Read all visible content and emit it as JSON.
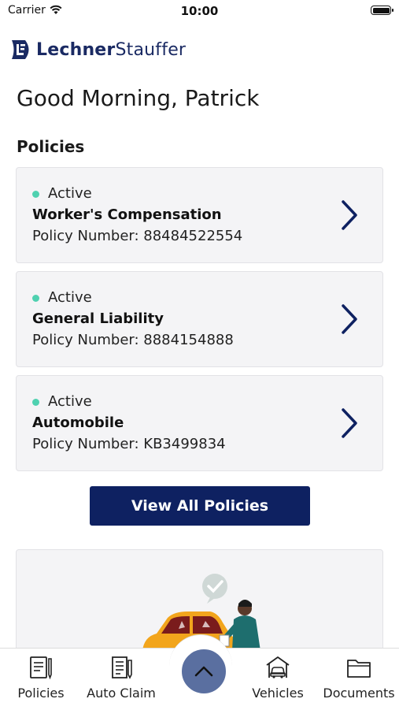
{
  "status_bar": {
    "carrier": "Carrier",
    "time": "10:00"
  },
  "brand": {
    "part1": "Lechner",
    "part2": "Stauffer"
  },
  "greeting": "Good Morning, Patrick",
  "policies_section": {
    "title": "Policies",
    "items": [
      {
        "status": "Active",
        "name": "Worker's Compensation",
        "policy_number": "Policy Number: 88484522554"
      },
      {
        "status": "Active",
        "name": "General Liability",
        "policy_number": "Policy Number: 8884154888"
      },
      {
        "status": "Active",
        "name": "Automobile",
        "policy_number": "Policy Number: KB3499834"
      }
    ],
    "view_all_label": "View All Policies"
  },
  "colors": {
    "brand_navy": "#0e2161",
    "active_dot": "#4fd1b0",
    "card_bg": "#f4f4f6",
    "center_button": "#5a6fa0"
  },
  "tab_bar": {
    "tabs": [
      {
        "label": "Policies",
        "icon": "document-pen-icon"
      },
      {
        "label": "Auto Claim",
        "icon": "claim-form-icon"
      },
      {
        "label": "Vehicles",
        "icon": "car-garage-icon"
      },
      {
        "label": "Documents",
        "icon": "folder-icon"
      }
    ],
    "center_icon": "chevron-up-icon"
  }
}
